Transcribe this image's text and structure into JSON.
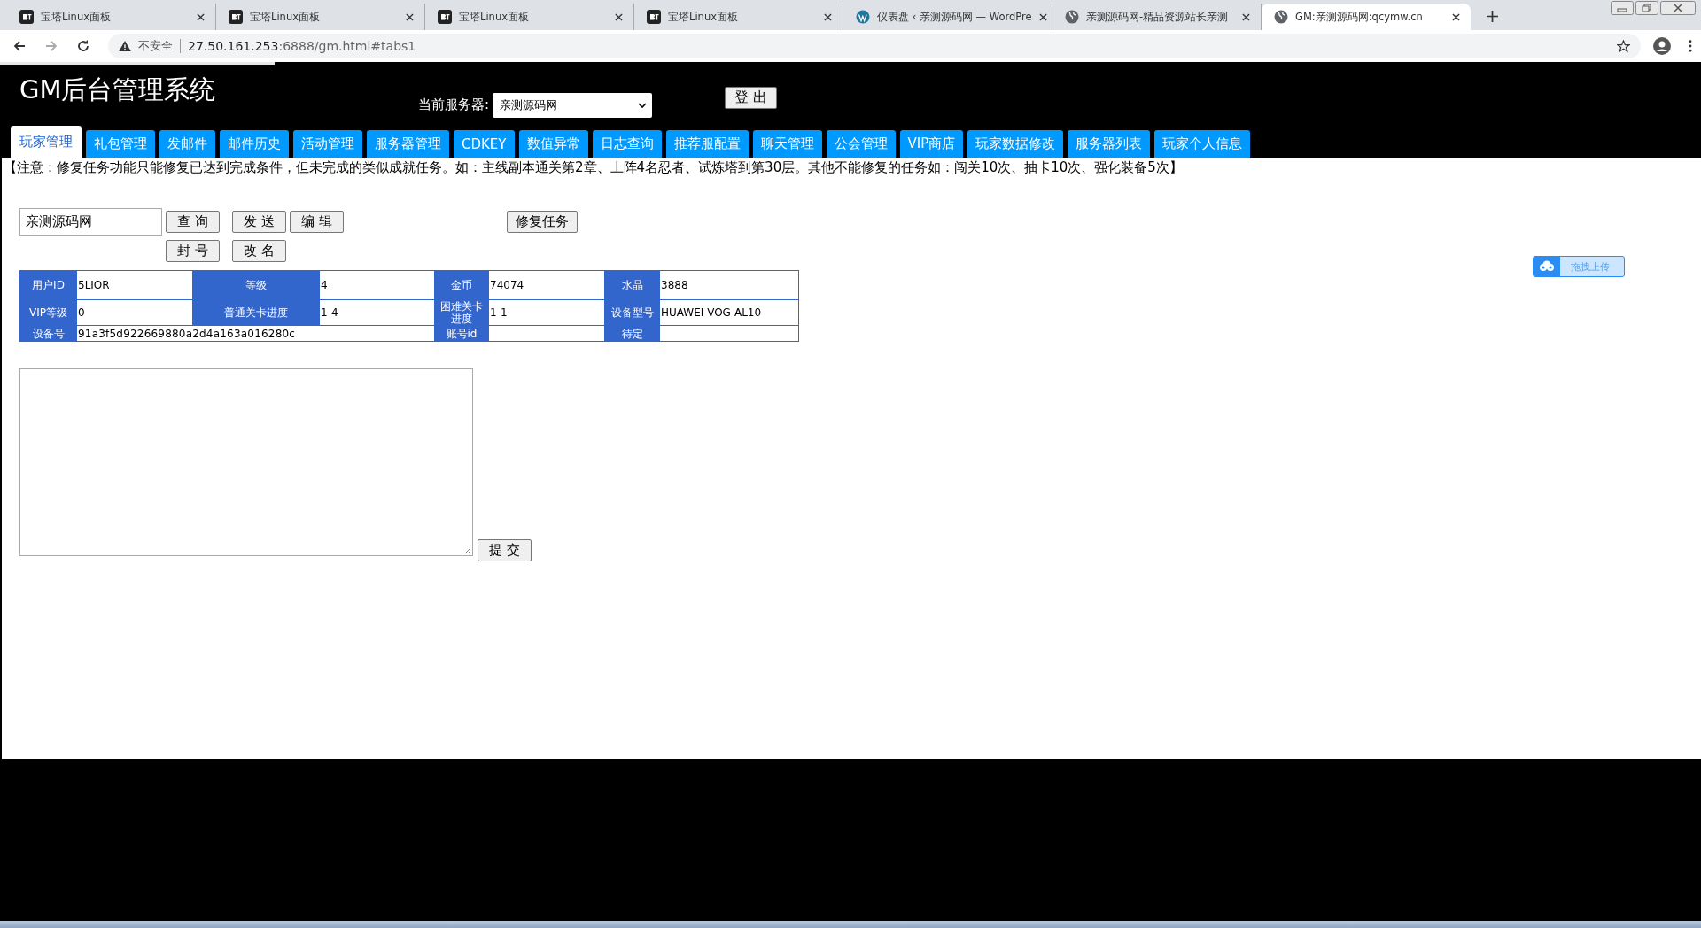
{
  "browser": {
    "tabs": [
      {
        "title": "宝塔Linux面板",
        "kind": "bt",
        "selected": false
      },
      {
        "title": "宝塔Linux面板",
        "kind": "bt",
        "selected": false
      },
      {
        "title": "宝塔Linux面板",
        "kind": "bt",
        "selected": false
      },
      {
        "title": "宝塔Linux面板",
        "kind": "bt",
        "selected": false
      },
      {
        "title": "仪表盘 ‹ 亲测源码网 — WordPre",
        "kind": "wordpress",
        "selected": false
      },
      {
        "title": "亲测源码网-精品资源站长亲测",
        "kind": "globe",
        "selected": false
      },
      {
        "title": "GM:亲测源码网:qcymw.cn",
        "kind": "globe",
        "selected": true
      }
    ],
    "security": "不安全",
    "url_host": "27.50.161.253",
    "url_rest": ":6888/gm.html#tabs1"
  },
  "header": {
    "title": "GM后台管理系统",
    "server_label": "当前服务器:",
    "server_value": "亲测源码网",
    "logout": "登 出"
  },
  "nav": [
    {
      "label": "玩家管理",
      "selected": true
    },
    {
      "label": "礼包管理",
      "selected": false
    },
    {
      "label": "发邮件",
      "selected": false
    },
    {
      "label": "邮件历史",
      "selected": false
    },
    {
      "label": "活动管理",
      "selected": false
    },
    {
      "label": "服务器管理",
      "selected": false
    },
    {
      "label": "CDKEY",
      "selected": false
    },
    {
      "label": "数值异常",
      "selected": false
    },
    {
      "label": "日志查询",
      "selected": false
    },
    {
      "label": "推荐服配置",
      "selected": false
    },
    {
      "label": "聊天管理",
      "selected": false
    },
    {
      "label": "公会管理",
      "selected": false
    },
    {
      "label": "VIP商店",
      "selected": false
    },
    {
      "label": "玩家数据修改",
      "selected": false
    },
    {
      "label": "服务器列表",
      "selected": false
    },
    {
      "label": "玩家个人信息",
      "selected": false
    }
  ],
  "notice": "【注意：修复任务功能只能修复已达到完成条件，但未完成的类似成就任务。如：主线副本通关第2章、上阵4名忍者、试炼塔到第30层。其他不能修复的任务如：闯关10次、抽卡10次、强化装备5次】",
  "player_search": {
    "value": "亲测源码网"
  },
  "buttons_row1": [
    "查 询",
    "发 送",
    "编 辑"
  ],
  "repair_button": "修复任务",
  "buttons_row2": [
    "封 号",
    "改 名"
  ],
  "player_table": [
    [
      {
        "label": "用户ID",
        "value": "5LIOR",
        "wide": false
      },
      {
        "label": "等级",
        "value": "4",
        "wide": false
      },
      {
        "label": "金币",
        "value": "74074",
        "wide": false
      },
      {
        "label": "水晶",
        "value": "3888",
        "wide": false
      }
    ],
    [
      {
        "label": "VIP等级",
        "value": "0",
        "wide": false
      },
      {
        "label": "普通关卡进度",
        "value": "1-4",
        "wide": false
      },
      {
        "label": "困难关卡进度",
        "value": "1-1",
        "wide": false
      },
      {
        "label": "设备型号",
        "value": "HUAWEI VOG-AL10",
        "wide": false
      }
    ],
    [
      {
        "label": "设备号",
        "value": "91a3f5d922669880a2d4a163a016280c",
        "wide": true
      },
      {
        "label": "账号id",
        "wide": false
      },
      {
        "label": "待定",
        "wide": false
      }
    ]
  ],
  "submit": "提 交",
  "upload_widget": "拖拽上传"
}
